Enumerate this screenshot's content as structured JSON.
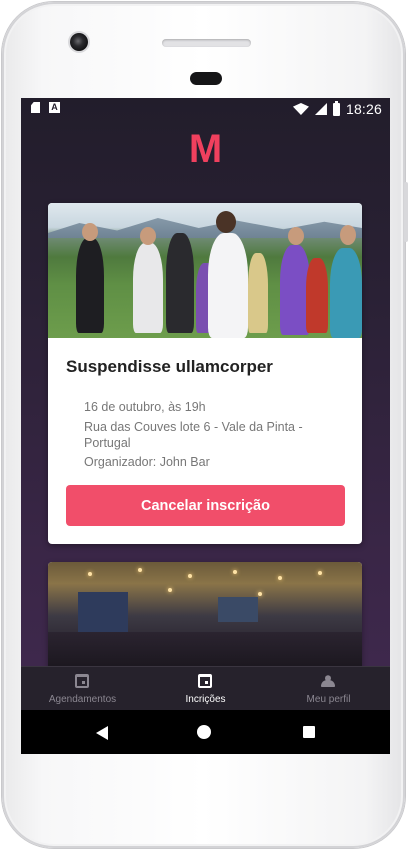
{
  "status_bar": {
    "time": "18:26",
    "notification_letter": "A",
    "icons": [
      "sd-card-icon",
      "notification-a-icon",
      "wifi-icon",
      "signal-icon",
      "battery-charging-icon"
    ]
  },
  "app": {
    "logo_text": "M",
    "accent_color": "#f14e6a",
    "background_color": "#2a2135"
  },
  "cards": [
    {
      "image": "sports-group-photo",
      "title": "Suspendisse ullamcorper",
      "date": "16 de outubro, às 19h",
      "address": "Rua das Couves lote 6 - Vale da Pinta - Portugal",
      "organizer": "Organizador: John Bar",
      "button_label": "Cancelar inscrição"
    },
    {
      "image": "crowded-restaurant-photo"
    }
  ],
  "bottom_nav": {
    "items": [
      {
        "label": "Agendamentos",
        "icon": "calendar-icon",
        "active": false
      },
      {
        "label": "Incrições",
        "icon": "calendar-check-icon",
        "active": true
      },
      {
        "label": "Meu perfil",
        "icon": "user-icon",
        "active": false
      }
    ]
  },
  "system_nav": {
    "icons": [
      "back-icon",
      "home-icon",
      "recent-apps-icon"
    ]
  }
}
